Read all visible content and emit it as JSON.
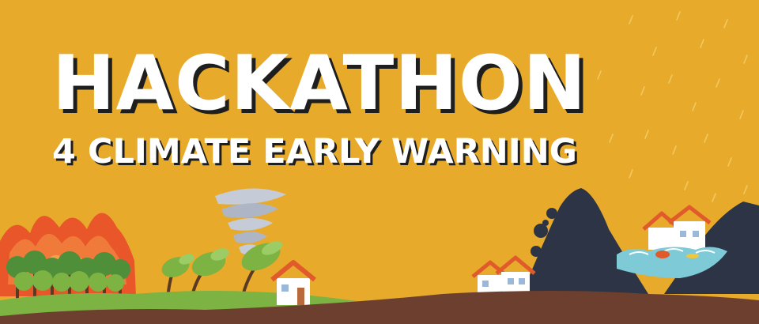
{
  "banner": {
    "title": "HACKATHON",
    "subtitle": "4 CLIMATE EARLY WARNING"
  },
  "colors": {
    "background": "#e8aa2a",
    "title_text": "#ffffff",
    "title_shadow": "#1e1e1e",
    "wildfire": "#e8562a",
    "grass": "#7cb342",
    "ground": "#6d3f2e",
    "mountain": "#2c3446",
    "flood_water": "#7ecad6",
    "tornado": "#c5ccd8",
    "house_roof": "#e15a2b"
  },
  "illustrations": [
    "wildfire-illustration",
    "tornado-illustration",
    "landslide-illustration",
    "flood-illustration",
    "rain-icon"
  ]
}
